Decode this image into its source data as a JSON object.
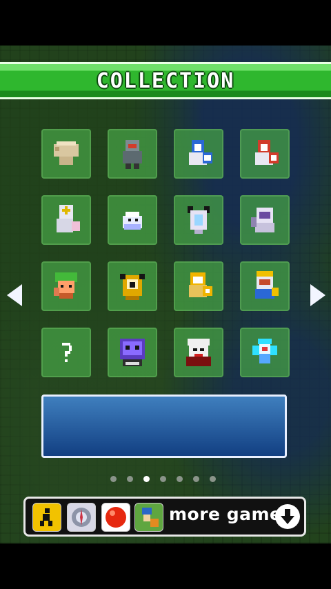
{
  "header": {
    "title": "COLLECTION"
  },
  "collection": {
    "rows": [
      [
        {
          "name": "mushroom-sprite",
          "kind": "mushroom"
        },
        {
          "name": "gray-soldier-sprite",
          "kind": "gray-soldier"
        },
        {
          "name": "blue-knight-sprite",
          "kind": "blue-knight"
        },
        {
          "name": "red-knight-sprite",
          "kind": "red-knight"
        }
      ],
      [
        {
          "name": "cross-knight-sprite",
          "kind": "cross-knight"
        },
        {
          "name": "slime-sprite",
          "kind": "slime"
        },
        {
          "name": "horned-skull-sprite",
          "kind": "horned-skull"
        },
        {
          "name": "white-mage-sprite",
          "kind": "white-mage"
        }
      ],
      [
        {
          "name": "green-elf-sprite",
          "kind": "green-elf"
        },
        {
          "name": "cyclops-sprite",
          "kind": "cyclops"
        },
        {
          "name": "golden-knight-sprite",
          "kind": "golden-knight"
        },
        {
          "name": "king-sprite",
          "kind": "king"
        }
      ],
      [
        {
          "name": "unknown-slot",
          "kind": "unknown",
          "label": "?"
        },
        {
          "name": "purple-beast-sprite",
          "kind": "purple-beast"
        },
        {
          "name": "vampire-sprite",
          "kind": "vampire"
        },
        {
          "name": "cyan-fairy-sprite",
          "kind": "cyan-fairy"
        }
      ]
    ]
  },
  "description": {
    "text": ""
  },
  "pagination": {
    "pages": 7,
    "current": 3
  },
  "ad_bar": {
    "icons": [
      "runner-icon",
      "gear-compass-icon",
      "red-ball-icon",
      "adventure-game-icon"
    ],
    "label": "more games",
    "icon_name": "download-arrow-icon"
  },
  "colors": {
    "banner_green": "#2fb72e",
    "tile_green": "#46a046",
    "desc_blue": "#1f5fa0",
    "frame_white": "#e8efff"
  }
}
